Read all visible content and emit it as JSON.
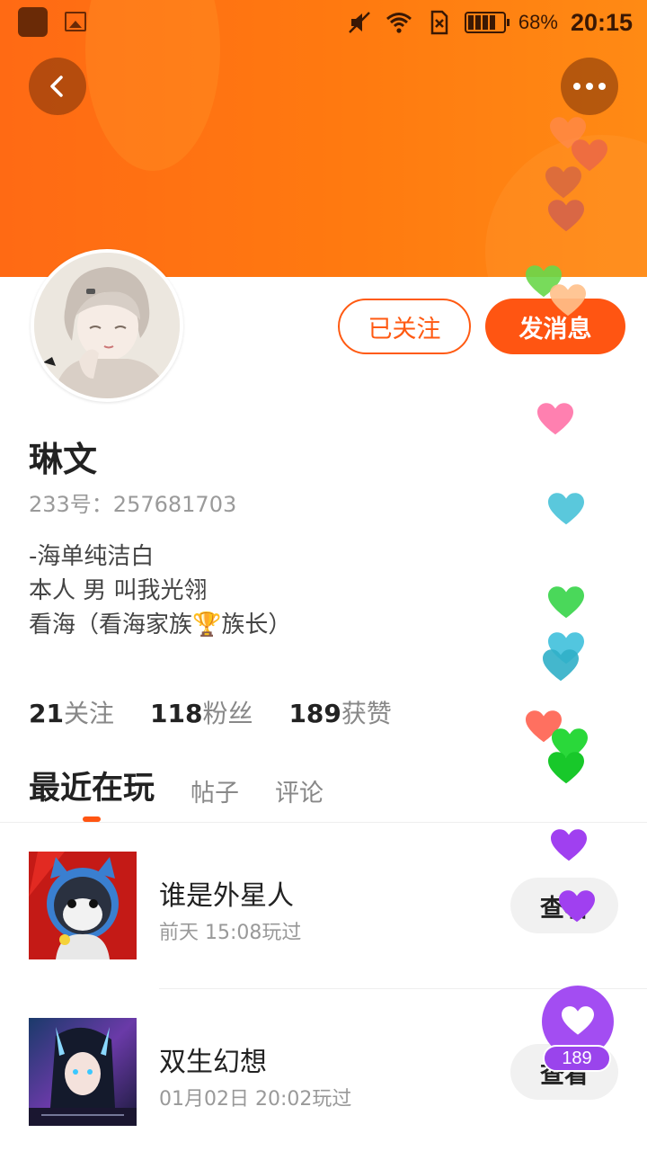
{
  "status_bar": {
    "battery": "68%",
    "time": "20:15"
  },
  "profile": {
    "follow_label": "已关注",
    "message_label": "发消息",
    "name": "琳文",
    "id_text": "233号：257681703",
    "bio_lines": [
      "-海单纯洁白",
      "本人 男  叫我光翎",
      "看海（看海家族🏆族长）"
    ]
  },
  "stats": [
    {
      "count": "21",
      "label": "关注"
    },
    {
      "count": "118",
      "label": "粉丝"
    },
    {
      "count": "189",
      "label": "获赞"
    }
  ],
  "tabs": [
    {
      "label": "最近在玩",
      "active": true
    },
    {
      "label": "帖子",
      "active": false
    },
    {
      "label": "评论",
      "active": false
    }
  ],
  "recent_games": [
    {
      "name": "谁是外星人",
      "played": "前天 15:08玩过",
      "action": "查看"
    },
    {
      "name": "双生幻想",
      "played": "01月02日 20:02玩过",
      "action": "查看"
    }
  ],
  "like_widget": {
    "count": "189"
  },
  "colors": {
    "accent": "#ff5512",
    "header_gradient_start": "#ff6a14",
    "header_gradient_end": "#ff8a14",
    "like_purple": "#a34df2"
  },
  "icons": [
    "back-arrow-icon",
    "more-dots-icon",
    "mute-icon",
    "wifi-icon",
    "no-sim-icon",
    "battery-icon",
    "heart-icon"
  ]
}
